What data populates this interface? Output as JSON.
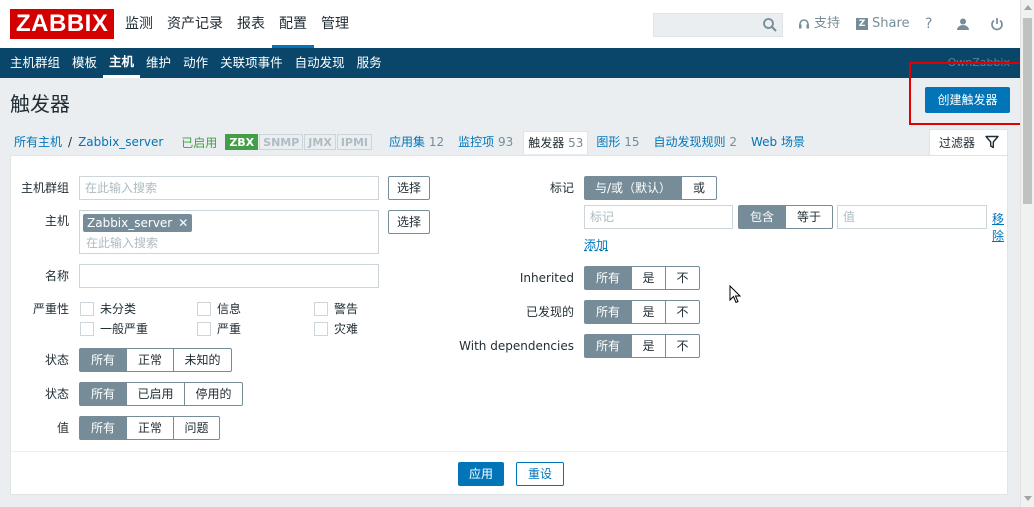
{
  "header": {
    "logo": "ZABBIX",
    "main_menu": [
      "监测",
      "资产记录",
      "报表",
      "配置",
      "管理"
    ],
    "active_main": 3,
    "search_value": "",
    "support_label": "支持",
    "share_label": "Share",
    "help_label": "?"
  },
  "submenu": {
    "items": [
      "主机群组",
      "模板",
      "主机",
      "维护",
      "动作",
      "关联项事件",
      "自动发现",
      "服务"
    ],
    "active_index": 2,
    "server_name": "OwnZabbix"
  },
  "page": {
    "title": "触发器",
    "create_button": "创建触发器"
  },
  "breadcrumbs": {
    "all_hosts": "所有主机",
    "separator": "/",
    "host": "Zabbix_server",
    "status": "已启用",
    "availability": [
      "ZBX",
      "SNMP",
      "JMX",
      "IPMI"
    ],
    "tabs": [
      {
        "label": "应用集",
        "count": "12"
      },
      {
        "label": "监控项",
        "count": "93"
      },
      {
        "label": "触发器",
        "count": "53"
      },
      {
        "label": "图形",
        "count": "15"
      },
      {
        "label": "自动发现规则",
        "count": "2"
      },
      {
        "label": "Web 场景",
        "count": ""
      }
    ]
  },
  "filter": {
    "tab_label": "过滤器",
    "host_group_label": "主机群组",
    "host_group_placeholder": "在此输入搜索",
    "select_label": "选择",
    "host_label": "主机",
    "host_chip": "Zabbix_server",
    "host_placeholder": "在此输入搜索",
    "name_label": "名称",
    "severity_label": "严重性",
    "severities": [
      "未分类",
      "信息",
      "警告",
      "一般严重",
      "严重",
      "灾难"
    ],
    "state_label": "状态",
    "state_options": [
      "所有",
      "正常",
      "未知的"
    ],
    "status_label": "状态",
    "status_options": [
      "所有",
      "已启用",
      "停用的"
    ],
    "value_label": "值",
    "value_options": [
      "所有",
      "正常",
      "问题"
    ],
    "tags_label": "标记",
    "tags_mode": [
      "与/或（默认）",
      "或"
    ],
    "tag_placeholder": "标记",
    "tag_operators": [
      "包含",
      "等于"
    ],
    "tag_value_placeholder": "值",
    "remove_label": "移除",
    "add_label": "添加",
    "inherited_label": "Inherited",
    "discovered_label": "已发现的",
    "dependencies_label": "With dependencies",
    "tri_options": [
      "所有",
      "是",
      "不"
    ],
    "apply_label": "应用",
    "reset_label": "重设"
  },
  "colors": {
    "brand_red": "#d40000",
    "subnav": "#0a466a",
    "primary": "#0275b8",
    "enabled_green": "#429e47",
    "segment_on": "#768d99"
  }
}
